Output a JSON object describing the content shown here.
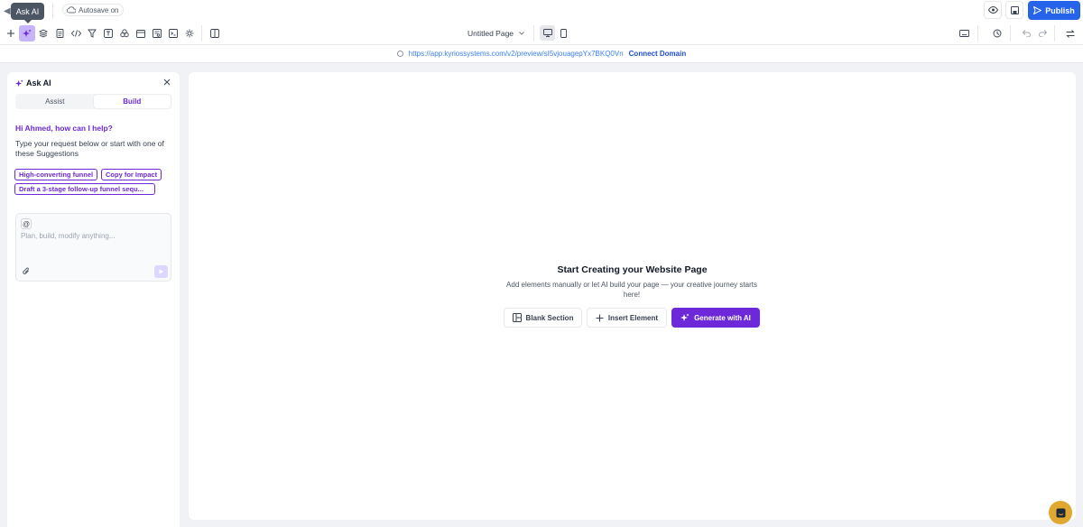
{
  "topbar": {
    "tooltip": "Ask AI",
    "autosave": "Autosave on",
    "publish_label": "Publish"
  },
  "toolbar": {
    "page_name": "Untitled Page",
    "tools": [
      "plus-icon",
      "sparkles-icon",
      "layers-icon",
      "page-icon",
      "code-icon",
      "funnel-icon",
      "template-icon",
      "puzzle-icon",
      "window-icon",
      "form-icon",
      "terminal-icon",
      "settings-icon",
      "sidebar-icon"
    ],
    "right_tools": [
      "keyboard-icon",
      "history-icon",
      "undo-icon",
      "redo-icon",
      "swap-icon"
    ]
  },
  "urlbar": {
    "url": "https://app.kyriossystems.com/v2/preview/sI5vjouagepYx7BKQ0Vn",
    "connect": "Connect Domain"
  },
  "panel": {
    "title": "Ask AI",
    "tabs": [
      "Assist",
      "Build"
    ],
    "active_tab": "Build",
    "greeting": "Hi Ahmed, how can I help?",
    "intro": "Type your request below or start with one of these Suggestions",
    "suggestions": [
      "High-converting funnel",
      "Copy for Impact",
      "Draft a 3-stage follow-up funnel sequ..."
    ],
    "at_symbol": "@",
    "placeholder": "Plan, build, modify anything..."
  },
  "canvas": {
    "title": "Start Creating your Website Page",
    "subtitle": "Add elements manually or let AI build your page — your creative journey starts here!",
    "blank_section": "Blank Section",
    "insert_element": "Insert Element",
    "generate_ai": "Generate with AI"
  },
  "colors": {
    "accent": "#6d28d9",
    "publish": "#2563eb",
    "chat": "#e0a82e"
  }
}
